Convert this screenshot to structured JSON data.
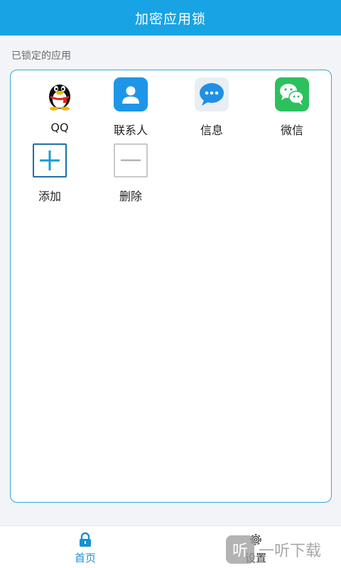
{
  "header": {
    "title": "加密应用锁"
  },
  "section": {
    "label": "已锁定的应用"
  },
  "apps": [
    {
      "label": "QQ",
      "icon": "qq-penguin-icon"
    },
    {
      "label": "联系人",
      "icon": "contacts-icon"
    },
    {
      "label": "信息",
      "icon": "messages-icon"
    },
    {
      "label": "微信",
      "icon": "wechat-icon"
    },
    {
      "label": "添加",
      "icon": "plus-icon"
    },
    {
      "label": "删除",
      "icon": "minus-icon"
    }
  ],
  "bottom_nav": {
    "home": {
      "label": "首页",
      "icon": "lock-icon",
      "active": true
    },
    "settings": {
      "label": "设置",
      "icon": "gear-icon",
      "active": false
    }
  },
  "watermark": {
    "logo_text": "听",
    "text": "一听下载"
  },
  "colors": {
    "primary": "#18a3e4",
    "card_border": "#36a7d8",
    "active_tab": "#1a8fd4",
    "background": "#f2f4f7"
  }
}
